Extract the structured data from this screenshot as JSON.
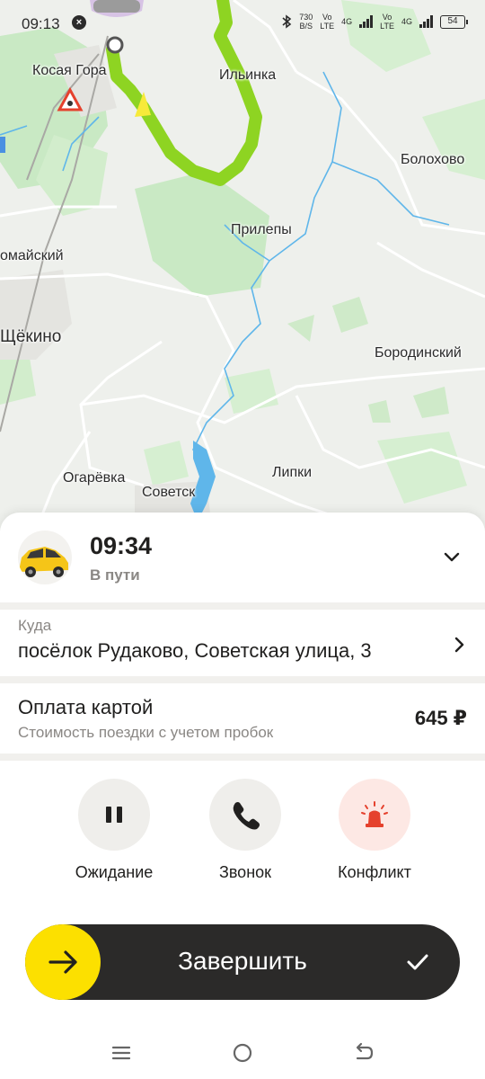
{
  "status_bar": {
    "time": "09:13",
    "net_speed_value": "730",
    "net_speed_unit": "B/S",
    "sim1_top": "Vo",
    "sim1_bottom": "LTE",
    "net1": "4G",
    "sim2_top": "Vo",
    "sim2_bottom": "LTE",
    "net2": "4G",
    "battery": "54"
  },
  "map": {
    "labels": {
      "kosaya_gora": "Косая Гора",
      "ilinka": "Ильинка",
      "bolokhovo": "Болохово",
      "prilepy": "Прилепы",
      "pervomaisky": "омайский",
      "shchekino": "Щёкино",
      "borodinsky": "Бородинский",
      "lipki": "Липки",
      "ogaryovka": "Огарёвка",
      "sovetsk": "Советск"
    },
    "colors": {
      "route": "#8ed422",
      "forest": "#c9e9c4",
      "water": "#5fb6ea",
      "road": "#ffffff"
    }
  },
  "trip": {
    "eta": "09:34",
    "status": "В пути"
  },
  "destination": {
    "label": "Куда",
    "address": "посёлок Рудаково, Советская улица, 3"
  },
  "payment": {
    "title": "Оплата картой",
    "subtitle": "Стоимость поездки с учетом пробок",
    "price": "645 ₽"
  },
  "actions": {
    "wait": {
      "label": "Ожидание",
      "icon": "pause-icon"
    },
    "call": {
      "label": "Звонок",
      "icon": "phone-icon"
    },
    "conflict": {
      "label": "Конфликт",
      "icon": "siren-icon"
    }
  },
  "finish": {
    "label": "Завершить",
    "accent": "#fce000"
  }
}
